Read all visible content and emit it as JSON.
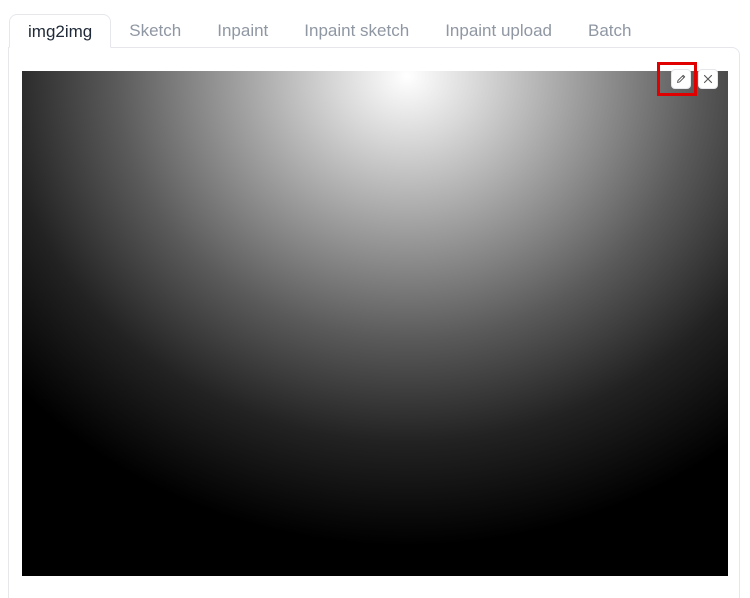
{
  "tabs": [
    {
      "label": "img2img",
      "active": true
    },
    {
      "label": "Sketch",
      "active": false
    },
    {
      "label": "Inpaint",
      "active": false
    },
    {
      "label": "Inpaint sketch",
      "active": false
    },
    {
      "label": "Inpaint upload",
      "active": false
    },
    {
      "label": "Batch",
      "active": false
    }
  ],
  "image_toolbar": {
    "edit_icon": "pencil-icon",
    "clear_icon": "close-icon"
  },
  "colors": {
    "highlight": "#e00000",
    "active_tab_text": "#1f2937",
    "inactive_tab_text": "#8f97a3",
    "border": "#e5e7eb"
  }
}
